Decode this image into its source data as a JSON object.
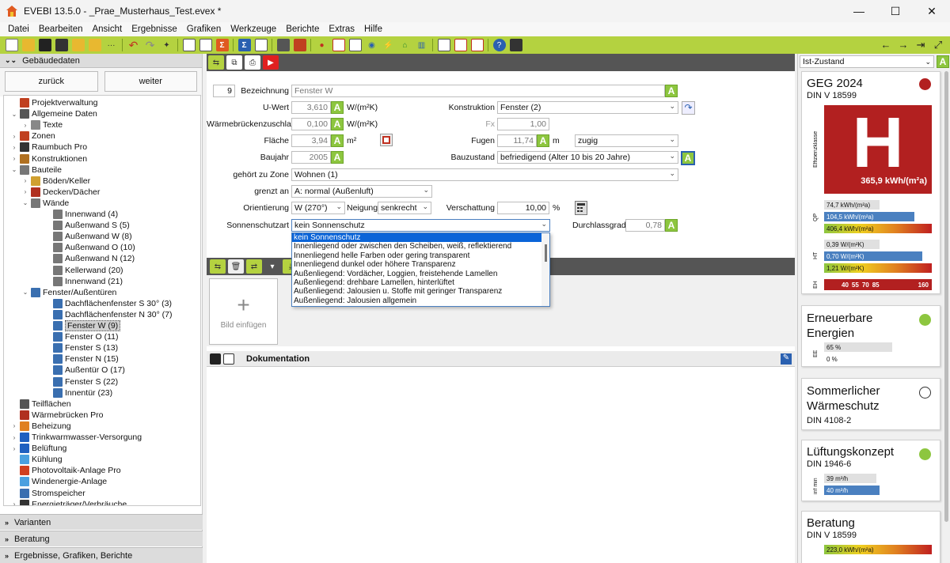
{
  "window": {
    "title": "EVEBI 13.5.0 - _Prae_Musterhaus_Test.evex *",
    "controls": [
      "—",
      "☐",
      "✕"
    ]
  },
  "menu": [
    "Datei",
    "Bearbeiten",
    "Ansicht",
    "Ergebnisse",
    "Grafiken",
    "Werkzeuge",
    "Berichte",
    "Extras",
    "Hilfe"
  ],
  "left": {
    "header": "Gebäudedaten",
    "back": "zurück",
    "forward": "weiter",
    "tree": [
      {
        "label": "Projektverwaltung",
        "exp": "",
        "ico": "#c04020"
      },
      {
        "label": "Allgemeine Daten",
        "exp": "⌄",
        "ico": "#555"
      },
      {
        "label": "Texte",
        "exp": "›",
        "ico": "#888"
      },
      {
        "label": "Zonen",
        "exp": "›",
        "ico": "#c04020"
      },
      {
        "label": "Raumbuch Pro",
        "exp": "›",
        "ico": "#333"
      },
      {
        "label": "Konstruktionen",
        "exp": "›",
        "ico": "#b07020"
      },
      {
        "label": "Bauteile",
        "exp": "⌄",
        "ico": "#777"
      },
      {
        "label": "Böden/Keller",
        "exp": "›",
        "ico": "#d0a030"
      },
      {
        "label": "Decken/Dächer",
        "exp": "›",
        "ico": "#b03020"
      },
      {
        "label": "Wände",
        "exp": "⌄",
        "ico": "#777"
      },
      {
        "label": "Innenwand (4)",
        "exp": "",
        "ico": "#777"
      },
      {
        "label": "Außenwand S (5)",
        "exp": "",
        "ico": "#777"
      },
      {
        "label": "Außenwand W (8)",
        "exp": "",
        "ico": "#777"
      },
      {
        "label": "Außenwand O (10)",
        "exp": "",
        "ico": "#777"
      },
      {
        "label": "Außenwand N (12)",
        "exp": "",
        "ico": "#777"
      },
      {
        "label": "Kellerwand (20)",
        "exp": "",
        "ico": "#777"
      },
      {
        "label": "Innenwand (21)",
        "exp": "",
        "ico": "#777"
      },
      {
        "label": "Fenster/Außentüren",
        "exp": "⌄",
        "ico": "#3a6fb0"
      },
      {
        "label": "Dachflächenfenster S 30° (3)",
        "exp": "",
        "ico": "#3a6fb0"
      },
      {
        "label": "Dachflächenfenster N 30° (7)",
        "exp": "",
        "ico": "#3a6fb0"
      },
      {
        "label": "Fenster W (9)",
        "exp": "",
        "ico": "#3a6fb0",
        "sel": true
      },
      {
        "label": "Fenster O (11)",
        "exp": "",
        "ico": "#3a6fb0"
      },
      {
        "label": "Fenster S (13)",
        "exp": "",
        "ico": "#3a6fb0"
      },
      {
        "label": "Fenster N (15)",
        "exp": "",
        "ico": "#3a6fb0"
      },
      {
        "label": "Außentür O (17)",
        "exp": "",
        "ico": "#3a6fb0"
      },
      {
        "label": "Fenster S (22)",
        "exp": "",
        "ico": "#3a6fb0"
      },
      {
        "label": "Innentür (23)",
        "exp": "",
        "ico": "#3a6fb0"
      },
      {
        "label": "Teilflächen",
        "exp": "",
        "ico": "#555"
      },
      {
        "label": "Wärmebrücken Pro",
        "exp": "",
        "ico": "#b03020"
      },
      {
        "label": "Beheizung",
        "exp": "›",
        "ico": "#e08020"
      },
      {
        "label": "Trinkwarmwasser-Versorgung",
        "exp": "›",
        "ico": "#2060c0"
      },
      {
        "label": "Belüftung",
        "exp": "›",
        "ico": "#2060c0"
      },
      {
        "label": "Kühlung",
        "exp": "",
        "ico": "#4aa0e0"
      },
      {
        "label": "Photovoltaik-Anlage Pro",
        "exp": "",
        "ico": "#d04020"
      },
      {
        "label": "Windenergie-Anlage",
        "exp": "",
        "ico": "#4aa0e0"
      },
      {
        "label": "Stromspeicher",
        "exp": "",
        "ico": "#3a6fb0"
      },
      {
        "label": "Energieträger/Verbräuche",
        "exp": "›",
        "ico": "#333"
      }
    ],
    "footer": [
      "Varianten",
      "Beratung",
      "Ergebnisse, Grafiken, Berichte"
    ]
  },
  "form": {
    "id": "9",
    "bezeichnung_label": "Bezeichnung",
    "bezeichnung": "Fenster W",
    "uwert_label": "U-Wert",
    "uwert": "3,610",
    "uwert_unit": "W/(m²K)",
    "wbz_label": "Wärmebrückenzuschlag",
    "wbz": "0,100",
    "wbz_unit": "W/(m²K)",
    "flaeche_label": "Fläche",
    "flaeche": "3,94",
    "flaeche_unit": "m²",
    "baujahr_label": "Baujahr",
    "baujahr": "2005",
    "zone_label": "gehört zu Zone",
    "zone": "Wohnen (1)",
    "grenzt_label": "grenzt an",
    "grenzt": "A: normal (Außenluft)",
    "orient_label": "Orientierung",
    "orient": "W (270°)",
    "neigung_label": "Neigung",
    "neigung": "senkrecht",
    "verschattung_label": "Verschattung",
    "verschattung": "10,00",
    "verschattung_unit": "%",
    "sonnenschutz_label": "Sonnenschutzart",
    "sonnenschutz": "kein Sonnenschutz",
    "durchlass_label": "Durchlassgrad",
    "durchlass": "0,78",
    "konstruktion_label": "Konstruktion",
    "konstruktion": "Fenster (2)",
    "fx_label": "Fx",
    "fx": "1,00",
    "fugen_label": "Fugen",
    "fugen": "11,74",
    "fugen_unit": "m",
    "fugen_art": "zugig",
    "bauzustand_label": "Bauzustand",
    "bauzustand": "befriedigend (Alter 10 bis 20 Jahre)",
    "a_label": "A"
  },
  "dropdown_options": [
    "kein Sonnenschutz",
    "Innenliegend oder zwischen den Scheiben, weiß, reflektierend",
    "Innenliegend helle Farben oder gering transparent",
    "Innenliegend dunkel oder höhere Transparenz",
    "Außenliegend: Vordächer, Loggien, freistehende Lamellen",
    "Außenliegend: drehbare Lamellen, hinterlüftet",
    "Außenliegend: Jalousien u. Stoffe mit geringer Transparenz",
    "Außenliegend: Jalousien allgemein"
  ],
  "image": {
    "plus": "+",
    "label": "Bild einfügen"
  },
  "doc": {
    "title": "Dokumentation"
  },
  "right": {
    "state": "Ist-Zustand",
    "geg": {
      "title": "GEG 2024",
      "subtitle": "DIN V 18599",
      "side_label": "Effizienzklasse",
      "class": "H",
      "value": "365,9 kWh/(m²a)",
      "qp_label": "QP",
      "qp": [
        "74,7 kWh/(m²a)",
        "104,5 kWh/(m²a)",
        "406,4 kWh/(m²a)"
      ],
      "ht_label": "HT",
      "ht": [
        "0,39 W/(m²K)",
        "0,70 W/(m²K)",
        "1,21 W/(m²K)"
      ],
      "eh_label": "EH",
      "eh": [
        "40",
        "55",
        "70",
        "85",
        "160"
      ]
    },
    "ee": {
      "title": "Erneuerbare Energien",
      "side_label": "EE",
      "vals": [
        "65 %",
        "0 %"
      ]
    },
    "swa": {
      "title": "Sommerlicher Wärmeschutz",
      "subtitle": "DIN 4108-2"
    },
    "luft": {
      "title": "Lüftungskonzept",
      "subtitle": "DIN 1946-6",
      "side_label": "inf min",
      "vals": [
        "39 m³/h",
        "40 m³/h"
      ]
    },
    "beratung": {
      "title": "Beratung",
      "subtitle": "DIN V 18599",
      "val": "223,0 kWh/(m²a)"
    }
  },
  "colors": {
    "accent": "#b4d240",
    "class_red": "#b22020",
    "status_green": "#8dc63f",
    "status_red": "#b22020",
    "select_blue": "#0a64d8"
  }
}
